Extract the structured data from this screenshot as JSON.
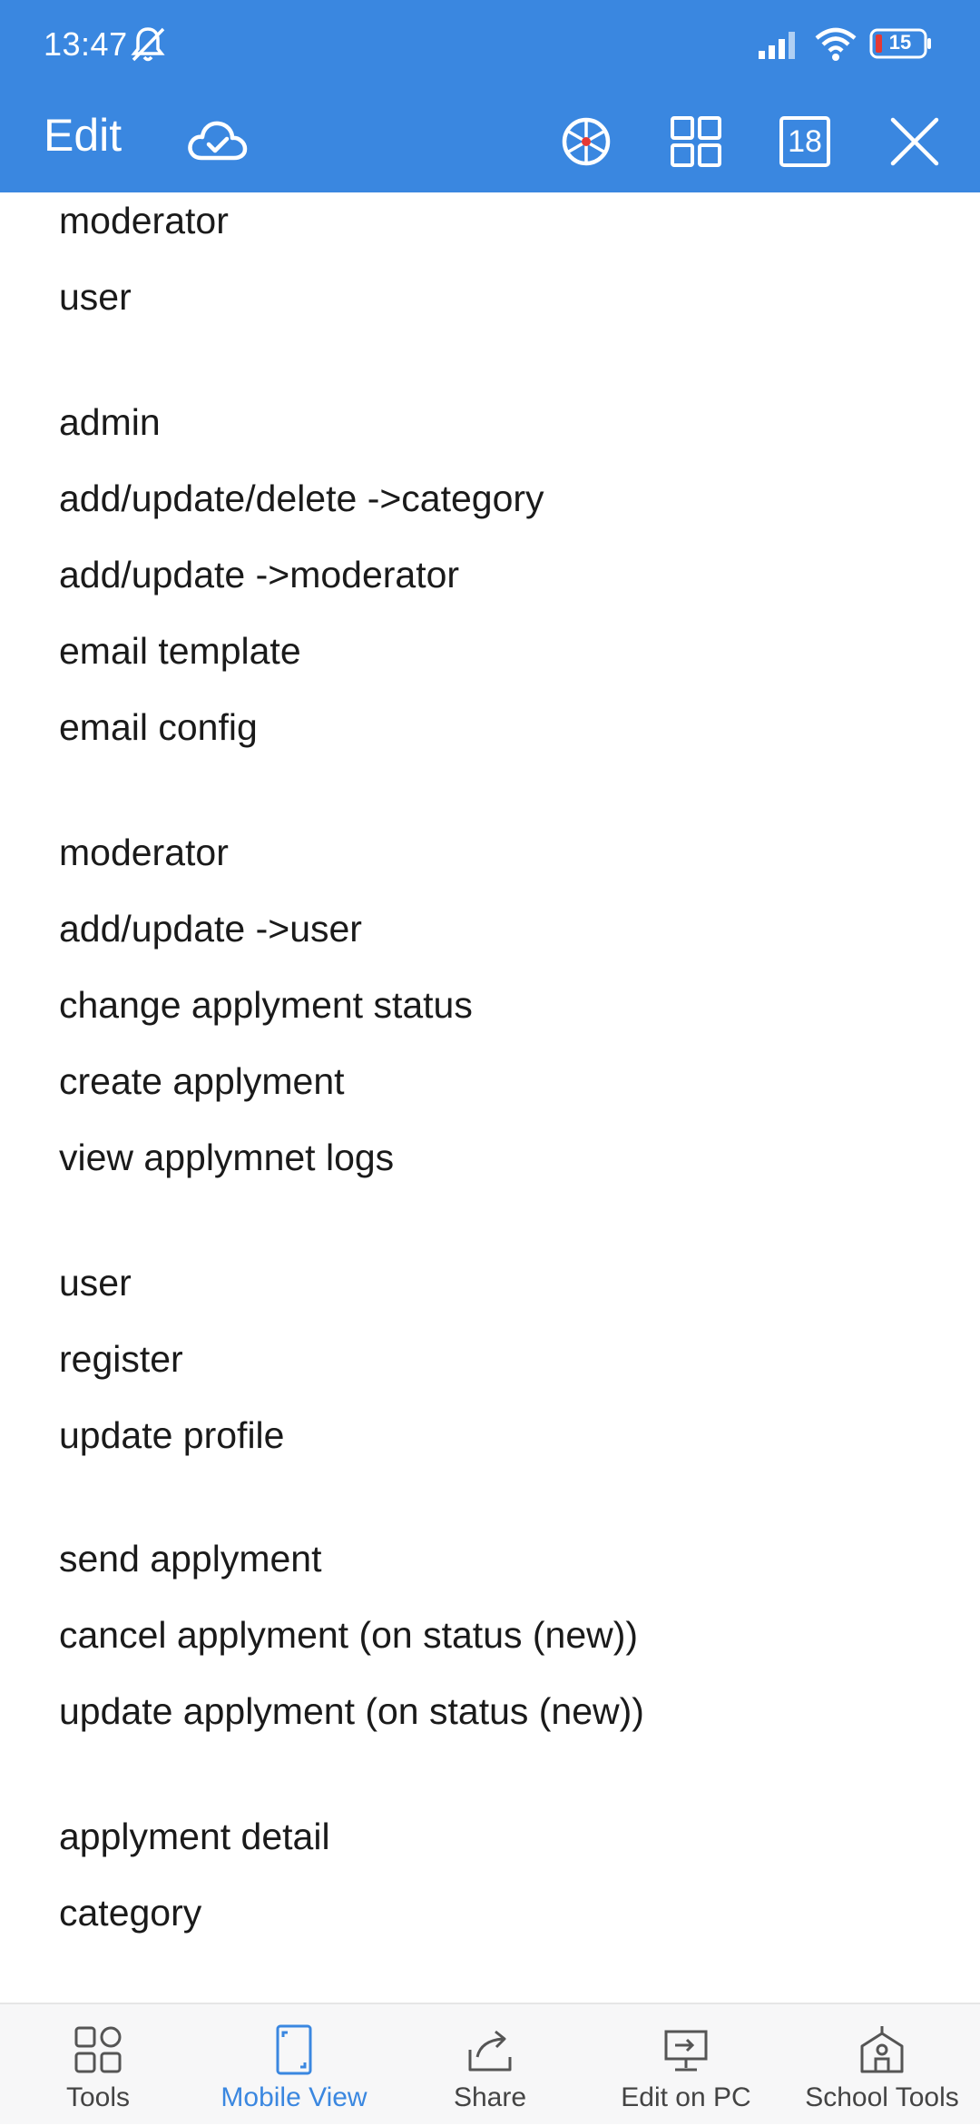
{
  "status": {
    "time": "13:47",
    "battery": "15",
    "icons": [
      "bell-off-icon",
      "signal-icon",
      "wifi-icon",
      "battery-icon"
    ]
  },
  "toolbar": {
    "title": "Edit",
    "pages_count": "18",
    "icons": [
      "cloud-sync-icon",
      "wheel-icon",
      "grid-view-icon",
      "pages-icon",
      "close-icon"
    ]
  },
  "content": {
    "lines": [
      "moderator",
      "user",
      "admin",
      "add/update/delete ->category",
      "add/update ->moderator",
      "email template",
      "email config",
      "moderator",
      "add/update ->user",
      "change applyment status",
      "create applyment",
      "view applymnet logs",
      "user",
      "register",
      "update profile",
      "send applyment",
      "cancel applyment (on status (new))",
      "update applyment (on status (new))",
      "applyment detail",
      "category"
    ]
  },
  "bottom_nav": {
    "tabs": [
      {
        "label": "Tools",
        "icon": "tools-icon"
      },
      {
        "label": "Mobile View",
        "icon": "mobile-view-icon",
        "active": true
      },
      {
        "label": "Share",
        "icon": "share-icon"
      },
      {
        "label": "Edit on PC",
        "icon": "edit-on-pc-icon"
      },
      {
        "label": "School Tools",
        "icon": "school-tools-icon"
      }
    ]
  },
  "colors": {
    "accent": "#3a87e0",
    "text": "#1a1a1a",
    "nav_background": "#f7f7f8"
  }
}
